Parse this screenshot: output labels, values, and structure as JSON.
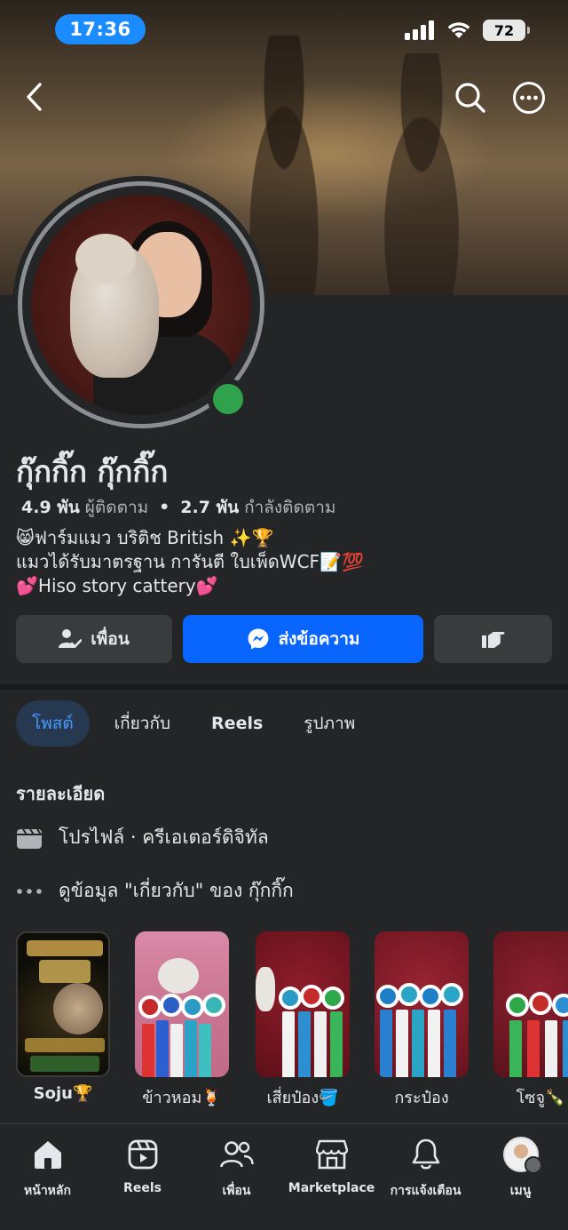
{
  "status": {
    "time": "17:36",
    "battery": "72"
  },
  "profile": {
    "name": "กุ๊กกิ๊ก กุ๊กกิ๊ก",
    "followers_count": "4.9 พัน",
    "followers_label": "ผู้ติดตาม",
    "following_count": "2.7 พัน",
    "following_label": "กำลังติดตาม",
    "separator": "•",
    "bio": [
      "😸ฟาร์มแมว บริติช British  ✨🏆",
      "แมวได้รับมาตรฐาน การันตี ใบเพ็ดWCF📝💯",
      "💕Hiso story cattery💕"
    ]
  },
  "actions": {
    "friends_label": "เพื่อน",
    "message_label": "ส่งข้อความ"
  },
  "tabs": [
    {
      "label": "โพสต์",
      "active": true
    },
    {
      "label": "เกี่ยวกับ",
      "active": false
    },
    {
      "label": "Reels",
      "active": false
    },
    {
      "label": "รูปภาพ",
      "active": false
    }
  ],
  "details": {
    "title": "รายละเอียด",
    "profile_type": "โปรไฟล์ · ครีเอเตอร์ดิจิทัล",
    "about_link": "ดูข้อมูล \"เกี่ยวกับ\" ของ กุ๊กกิ๊ก"
  },
  "highlights": [
    {
      "label": "Soju🏆",
      "card_text": {
        "congrats": "Congratulations",
        "rank": "1st Lord",
        "sub": "of Household Pets",
        "year": "2024, THAILAND",
        "name": "LORD. Soju"
      }
    },
    {
      "label": "ข้าวหอม🍹"
    },
    {
      "label": "เสี่ยป๋อง🪣"
    },
    {
      "label": "กระป๋อง"
    },
    {
      "label": "โซจู🍾"
    }
  ],
  "bottom_nav": [
    {
      "label": "หน้าหลัก",
      "icon": "home-icon",
      "active": true
    },
    {
      "label": "Reels",
      "icon": "reels-icon",
      "active": false
    },
    {
      "label": "เพื่อน",
      "icon": "friends-icon",
      "active": false
    },
    {
      "label": "Marketplace",
      "icon": "marketplace-icon",
      "active": false
    },
    {
      "label": "การแจ้งเตือน",
      "icon": "bell-icon",
      "active": false
    },
    {
      "label": "เมนู",
      "icon": "menu-avatar-icon",
      "active": false
    }
  ],
  "colors": {
    "accent": "#0866ff",
    "background": "#242526",
    "button": "#3a3b3c",
    "online": "#31a24c",
    "active_tab_bg": "#263951",
    "active_tab_text": "#4599ff"
  }
}
